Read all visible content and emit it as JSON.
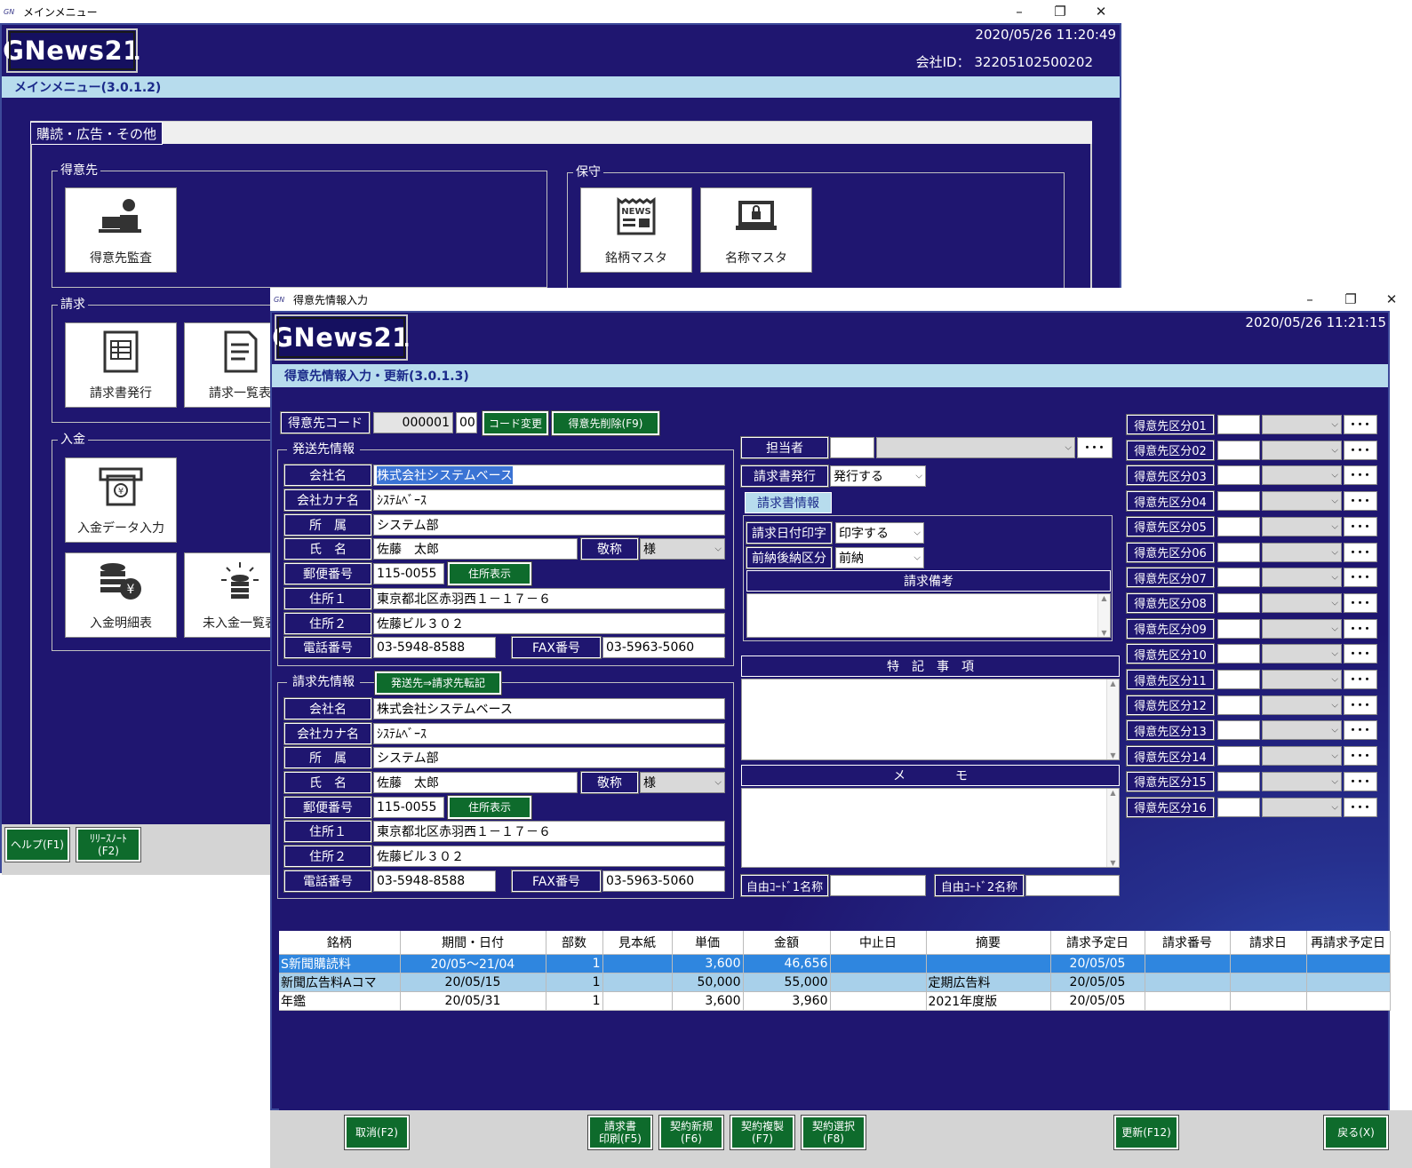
{
  "main_window": {
    "title": "メインメニュー",
    "logo": "GNews21",
    "datetime": "2020/05/26 11:20:49",
    "company_id_label": "会社ID：",
    "company_id": "32205102500202",
    "screen_title": "メインメニュー(3.0.1.2)",
    "tab": "購読・広告・その他",
    "groups": {
      "customer": "得意先",
      "maintenance": "保守",
      "billing": "請求",
      "payment": "入金"
    },
    "tiles": {
      "customer_audit": "得意先監査",
      "brand_master": "銘柄マスタ",
      "name_master": "名称マスタ",
      "invoice_issue": "請求書発行",
      "invoice_list": "請求一覧表",
      "payment_entry": "入金データ入力",
      "payment_detail": "入金明細表",
      "unpaid_list": "未入金一覧表"
    },
    "footer": {
      "help": "ヘルプ(F1)",
      "release_note_1": "ﾘﾘｰｽﾉｰﾄ",
      "release_note_2": "(F2)"
    }
  },
  "customer_window": {
    "title": "得意先情報入力",
    "logo": "GNews21",
    "datetime": "2020/05/26 11:21:15",
    "screen_title": "得意先情報入力・更新(3.0.1.3)",
    "customer_code_label": "得意先コード",
    "customer_code": "000001",
    "customer_code_sub": "00",
    "code_change": "コード変更",
    "delete_button": "得意先削除(F9)",
    "shipping": {
      "section": "発送先情報",
      "company_label": "会社名",
      "company": "株式会社システムベース",
      "kana_label": "会社カナ名",
      "kana": "ｼｽﾃﾑﾍﾞｰｽ",
      "dept_label": "所　属",
      "dept": "システム部",
      "name_label": "氏　名",
      "name": "佐藤　太郎",
      "honorific_label": "敬称",
      "honorific": "様",
      "zip_label": "郵便番号",
      "zip": "115-0055",
      "address_button": "住所表示",
      "addr1_label": "住所１",
      "addr1": "東京都北区赤羽西１－１７－６",
      "addr2_label": "住所２",
      "addr2": "佐藤ビル３０２",
      "tel_label": "電話番号",
      "tel": "03-5948-8588",
      "fax_label": "FAX番号",
      "fax": "03-5963-5060"
    },
    "billing": {
      "section": "請求先情報",
      "copy_button": "発送先⇒請求先転記",
      "company_label": "会社名",
      "company": "株式会社システムベース",
      "kana_label": "会社カナ名",
      "kana": "ｼｽﾃﾑﾍﾞｰｽ",
      "dept_label": "所　属",
      "dept": "システム部",
      "name_label": "氏　名",
      "name": "佐藤　太郎",
      "honorific_label": "敬称",
      "honorific": "様",
      "zip_label": "郵便番号",
      "zip": "115-0055",
      "address_button": "住所表示",
      "addr1_label": "住所１",
      "addr1": "東京都北区赤羽西１－１７－６",
      "addr2_label": "住所２",
      "addr2": "佐藤ビル３０２",
      "tel_label": "電話番号",
      "tel": "03-5948-8588",
      "fax_label": "FAX番号",
      "fax": "03-5963-5060"
    },
    "staff_label": "担当者",
    "invoice_issue_label": "請求書発行",
    "invoice_issue_value": "発行する",
    "invoice_info_tab": "請求書情報",
    "print_date_label": "請求日付印字",
    "print_date_value": "印字する",
    "prepay_label": "前納後納区分",
    "prepay_value": "前納",
    "invoice_note_label": "請求備考",
    "special_notes_label": "特　記　事　項",
    "memo_label": "メ　　　　モ",
    "free_code1_label": "自由ｺｰﾄﾞ1名称",
    "free_code2_label": "自由ｺｰﾄﾞ2名称",
    "categories": [
      "得意先区分01",
      "得意先区分02",
      "得意先区分03",
      "得意先区分04",
      "得意先区分05",
      "得意先区分06",
      "得意先区分07",
      "得意先区分08",
      "得意先区分09",
      "得意先区分10",
      "得意先区分11",
      "得意先区分12",
      "得意先区分13",
      "得意先区分14",
      "得意先区分15",
      "得意先区分16"
    ],
    "dots": "･･･",
    "table": {
      "headers": [
        "銘柄",
        "期間・日付",
        "部数",
        "見本紙",
        "単価",
        "金額",
        "中止日",
        "摘要",
        "請求予定日",
        "請求番号",
        "請求日",
        "再請求予定日"
      ],
      "rows": [
        [
          "S新聞購読料",
          "20/05～21/04",
          "1",
          "",
          "3,600",
          "46,656",
          "",
          "",
          "20/05/05",
          "",
          "",
          ""
        ],
        [
          "新聞広告料Aコマ",
          "20/05/15",
          "1",
          "",
          "50,000",
          "55,000",
          "",
          "定期広告料",
          "20/05/05",
          "",
          "",
          ""
        ],
        [
          "年鑑",
          "20/05/31",
          "1",
          "",
          "3,600",
          "3,960",
          "",
          "2021年度版",
          "20/05/05",
          "",
          "",
          ""
        ]
      ]
    },
    "footer": {
      "cancel": "取消(F2)",
      "invoice_print_1": "請求書",
      "invoice_print_2": "印刷(F5)",
      "contract_new_1": "契約新規",
      "contract_new_2": "(F6)",
      "contract_copy_1": "契約複製",
      "contract_copy_2": "(F7)",
      "contract_select_1": "契約選択",
      "contract_select_2": "(F8)",
      "update": "更新(F12)",
      "back": "戻る(X)"
    }
  }
}
